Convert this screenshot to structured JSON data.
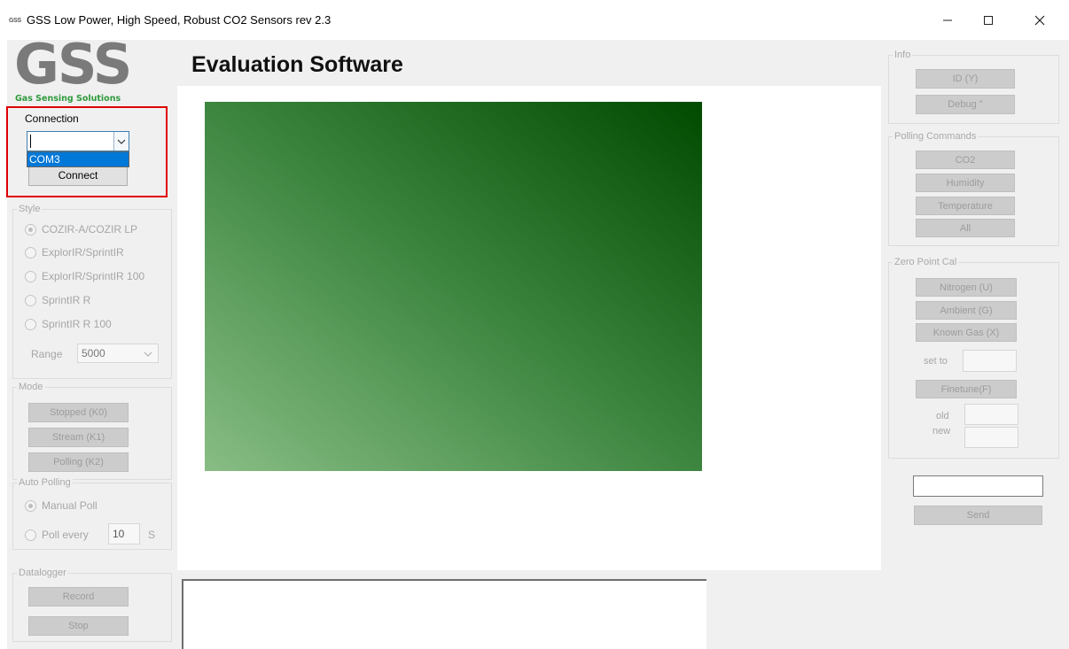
{
  "window": {
    "icon_text": "GSS",
    "title": "GSS Low Power, High Speed, Robust  CO2 Sensors  rev 2.3"
  },
  "logo": {
    "text": "GSS",
    "subtitle": "Gas Sensing Solutions"
  },
  "header": {
    "title": "Evaluation Software"
  },
  "connection": {
    "title": "Connection",
    "combo_value": "",
    "dropdown_options": [
      "COM3"
    ],
    "connect_label": "Connect"
  },
  "style": {
    "title": "Style",
    "options": [
      "COZIR-A/COZIR LP",
      "ExplorIR/SprintIR",
      "ExplorIR/SprintIR 100",
      "SprintIR R",
      "SprintIR R 100"
    ],
    "selected_index": 0,
    "range_label": "Range",
    "range_value": "5000"
  },
  "mode": {
    "title": "Mode",
    "buttons": [
      "Stopped (K0)",
      "Stream (K1)",
      "Polling (K2)"
    ]
  },
  "auto_polling": {
    "title": "Auto Polling",
    "manual_label": "Manual Poll",
    "poll_every_label": "Poll every",
    "poll_value": "10",
    "unit": "S"
  },
  "datalogger": {
    "title": "Datalogger",
    "record_label": "Record",
    "stop_label": "Stop"
  },
  "info": {
    "title": "Info",
    "buttons": [
      "ID (Y)",
      "Debug \""
    ]
  },
  "polling_commands": {
    "title": "Polling Commands",
    "buttons": [
      "CO2",
      "Humidity",
      "Temperature",
      "All"
    ]
  },
  "zero_point": {
    "title": "Zero Point Cal",
    "buttons": [
      "Nitrogen (U)",
      "Ambient (G)",
      "Known Gas (X)"
    ],
    "set_to_label": "set to",
    "finetune_label": "Finetune(F)",
    "old_label": "old",
    "new_label": "new"
  },
  "send": {
    "input_value": "",
    "button_label": "Send"
  },
  "colors": {
    "highlight": "#e00000",
    "selection": "#0078d7",
    "chart_dark": "#004a00",
    "chart_light": "#88bd84",
    "logo_green": "#2e9a3c"
  }
}
